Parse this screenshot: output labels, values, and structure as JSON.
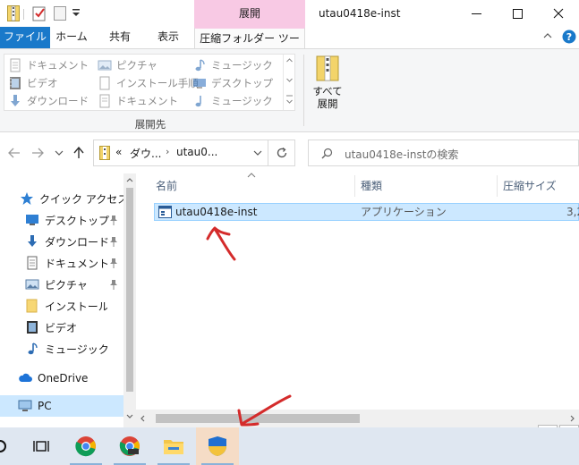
{
  "window": {
    "title": "utau0418e-inst",
    "context_header": "展開",
    "controls": {
      "minimize": "minimize",
      "maximize": "maximize",
      "close": "close"
    }
  },
  "ribbon": {
    "tabs": [
      "ファイル",
      "ホーム",
      "共有",
      "表示",
      "圧縮フォルダー ツール"
    ],
    "destinations": [
      [
        "ドキュメント",
        "ピクチャ",
        "ミュージック"
      ],
      [
        "ビデオ",
        "インストール手順",
        "デスクトップ"
      ],
      [
        "ダウンロード",
        "ドキュメント",
        "ミュージック"
      ]
    ],
    "group_label": "展開先",
    "extract_all": [
      "すべて",
      "展開"
    ]
  },
  "address": {
    "prefix": "«",
    "crumbs": [
      "ダウ...",
      "utau0..."
    ],
    "search_placeholder": "utau0418e-instの検索"
  },
  "navpane": {
    "quick_access": "クイック アクセス",
    "items": [
      "デスクトップ",
      "ダウンロード",
      "ドキュメント",
      "ピクチャ",
      "インストール手順",
      "ビデオ",
      "ミュージック"
    ],
    "onedrive": "OneDrive",
    "pc": "PC"
  },
  "filelist": {
    "columns": [
      "名前",
      "種類",
      "圧縮サイズ"
    ],
    "rows": [
      {
        "name": "utau0418e-inst",
        "type": "アプリケーション",
        "size": "3,2"
      }
    ]
  },
  "colors": {
    "file_tab": "#1979ca",
    "context_tab": "#f8c9e4",
    "selection": "#cce8ff",
    "annotation": "#d42b2b",
    "taskbar": "#dfe7f1"
  }
}
